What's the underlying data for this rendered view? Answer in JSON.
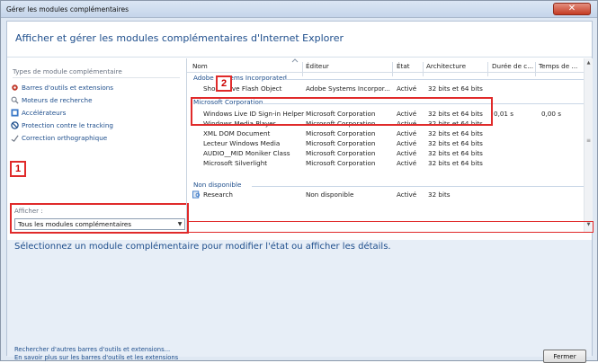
{
  "window": {
    "title": "Gérer les modules complémentaires",
    "close_glyph": "✕"
  },
  "header": {
    "title": "Afficher et gérer les modules complémentaires d'Internet Explorer"
  },
  "types": {
    "label": "Types de module complémentaire",
    "items": [
      {
        "label": "Barres d'outils et extensions",
        "icon": "gear-icon"
      },
      {
        "label": "Moteurs de recherche",
        "icon": "search-icon"
      },
      {
        "label": "Accélérateurs",
        "icon": "accelerator-icon"
      },
      {
        "label": "Protection contre le tracking",
        "icon": "block-icon"
      },
      {
        "label": "Correction orthographique",
        "icon": "spellcheck-icon"
      }
    ]
  },
  "afficher": {
    "label": "Afficher :",
    "selected": "Tous les modules complémentaires",
    "arrow": "▼"
  },
  "callouts": {
    "one": "1",
    "two": "2"
  },
  "columns": {
    "nom": "Nom",
    "editeur": "Éditeur",
    "etat": "État",
    "architecture": "Architecture",
    "duree": "Durée de c...",
    "temps": "Temps de ..."
  },
  "groups": [
    {
      "name": "Adobe Systems Incorporated",
      "rows": [
        {
          "nom": "Shockwave Flash Object",
          "editeur": "Adobe Systems Incorpor...",
          "etat": "Activé",
          "arch": "32 bits et 64 bits",
          "duree": "",
          "temps": ""
        }
      ]
    },
    {
      "name": "Microsoft Corporation",
      "rows": [
        {
          "nom": "Windows Live ID Sign-in Helper",
          "editeur": "Microsoft Corporation",
          "etat": "Activé",
          "arch": "32 bits et 64 bits",
          "duree": "0,01 s",
          "temps": "0,00 s"
        },
        {
          "nom": "Windows Media Player",
          "editeur": "Microsoft Corporation",
          "etat": "Activé",
          "arch": "32 bits et 64 bits",
          "duree": "",
          "temps": ""
        },
        {
          "nom": "XML DOM Document",
          "editeur": "Microsoft Corporation",
          "etat": "Activé",
          "arch": "32 bits et 64 bits",
          "duree": "",
          "temps": ""
        },
        {
          "nom": "Lecteur Windows Media",
          "editeur": "Microsoft Corporation",
          "etat": "Activé",
          "arch": "32 bits et 64 bits",
          "duree": "",
          "temps": ""
        },
        {
          "nom": "AUDIO__MID Moniker Class",
          "editeur": "Microsoft Corporation",
          "etat": "Activé",
          "arch": "32 bits et 64 bits",
          "duree": "",
          "temps": ""
        },
        {
          "nom": "Microsoft Silverlight",
          "editeur": "Microsoft Corporation",
          "etat": "Activé",
          "arch": "32 bits et 64 bits",
          "duree": "",
          "temps": ""
        }
      ]
    },
    {
      "name": "Non disponible",
      "rows": [
        {
          "nom": "Research",
          "editeur": "Non disponible",
          "etat": "Activé",
          "arch": "32 bits",
          "duree": "",
          "temps": ""
        }
      ]
    }
  ],
  "details": {
    "prompt": "Sélectionnez un module complémentaire pour modifier l'état ou afficher les détails."
  },
  "footer": {
    "link1": "Rechercher d'autres barres d'outils et extensions...",
    "link2": "En savoir plus sur les barres d'outils et les extensions",
    "close_button": "Fermer"
  },
  "colors": {
    "accent": "#1e4e8c",
    "callout": "#e02a2a",
    "details_band": "#e7eef7"
  }
}
